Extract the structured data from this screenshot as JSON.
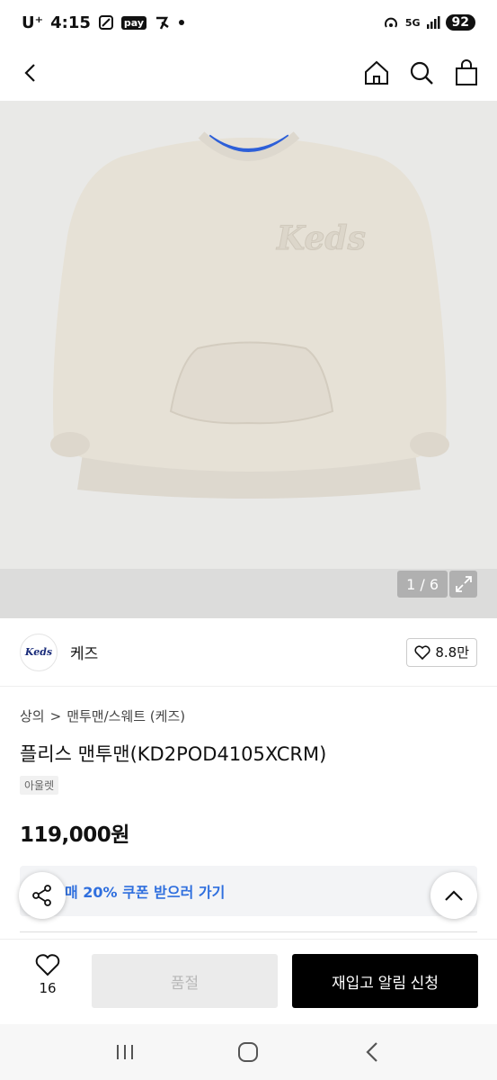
{
  "status_bar": {
    "carrier": "U⁺",
    "time": "4:15",
    "pay": "pay",
    "network": "5G",
    "battery": "92"
  },
  "icons": {
    "back": "chevron-left-icon",
    "home": "home-icon",
    "search": "search-icon",
    "bag": "shopping-bag-icon",
    "expand": "expand-icon",
    "heart": "heart-icon",
    "share": "share-icon",
    "scroll_top": "chevron-up-icon"
  },
  "gallery": {
    "counter": "1 / 6",
    "print_text": "Keds"
  },
  "brand": {
    "logo_text": "Keds",
    "name": "케즈",
    "likes": "8.8만"
  },
  "breadcrumb": {
    "level1": "상의",
    "separator": ">",
    "level2": "맨투맨/스웨트 (케즈)"
  },
  "product": {
    "title": "플리스 맨투맨(KD2POD4105XCRM)",
    "tag": "아울렛",
    "price": "119,000원"
  },
  "coupon": {
    "text": "매 20% 쿠폰 받으러 가기"
  },
  "bottom": {
    "wish_count": "16",
    "soldout_label": "품절",
    "restock_label": "재입고 알림 신청"
  },
  "colors": {
    "accent_blue": "#2f6fde",
    "hero_bg": "#e8e8e6",
    "sweater": "#e4ded3"
  }
}
